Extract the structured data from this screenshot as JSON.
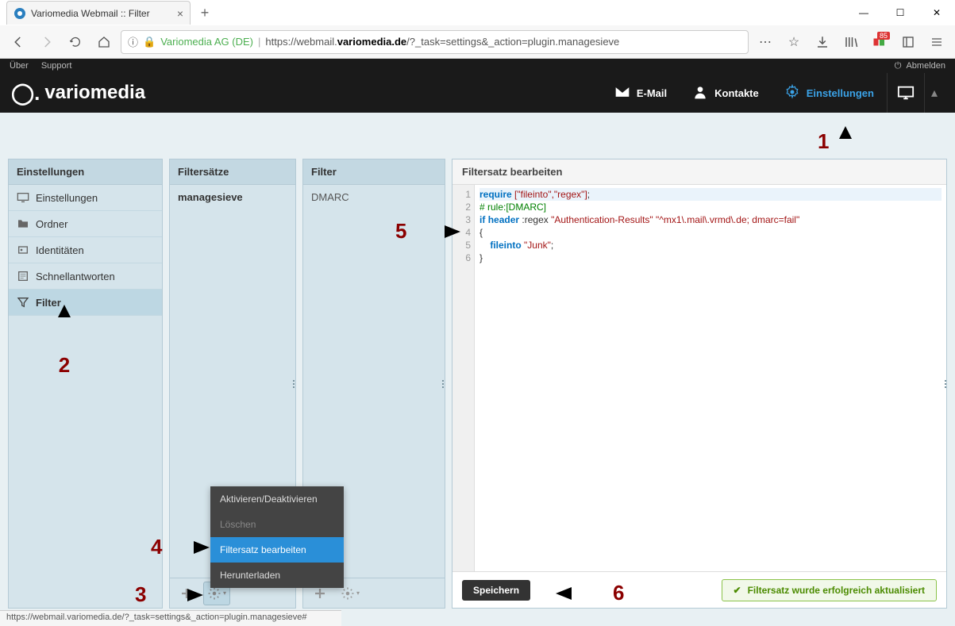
{
  "browser": {
    "tab_title": "Variomedia Webmail :: Filter",
    "site_name": "Variomedia AG (DE)",
    "url_host": "variomedia.de",
    "url_prefix": "https://webmail.",
    "url_path": "/?_task=settings&_action=plugin.managesieve",
    "badge_count": "85"
  },
  "meta": {
    "uber": "Über",
    "support": "Support",
    "logout": "Abmelden"
  },
  "logo_text": "variomedia",
  "header_nav": {
    "email": "E-Mail",
    "contacts": "Kontakte",
    "settings": "Einstellungen"
  },
  "panels": {
    "settings_title": "Einstellungen",
    "settings_items": [
      {
        "label": "Einstellungen",
        "icon": "monitor"
      },
      {
        "label": "Ordner",
        "icon": "folder"
      },
      {
        "label": "Identitäten",
        "icon": "person"
      },
      {
        "label": "Schnellantworten",
        "icon": "note"
      },
      {
        "label": "Filter",
        "icon": "filter",
        "active": true
      }
    ],
    "sets_title": "Filtersätze",
    "sets_items": [
      "managesieve"
    ],
    "filter_title": "Filter",
    "filter_items": [
      "DMARC"
    ]
  },
  "editor": {
    "title": "Filtersatz bearbeiten",
    "lines": [
      "1",
      "2",
      "3",
      "4",
      "5",
      "6"
    ],
    "code": {
      "l1_a": "require",
      "l1_b": "[\"fileinto\",\"regex\"]",
      "l1_c": ";",
      "l2": "# rule:[DMARC]",
      "l3_a": "if",
      "l3_b": "header",
      "l3_c": ":regex",
      "l3_d": "\"Authentication-Results\"",
      "l3_e": "\"^mx1\\.mail\\.vrmd\\.de; dmarc=fail\"",
      "l4": "{",
      "l5_a": "fileinto",
      "l5_b": "\"Junk\"",
      "l5_c": ";",
      "l6": "}"
    },
    "save": "Speichern",
    "success": "Filtersatz wurde erfolgreich aktualisiert"
  },
  "ctx": {
    "toggle": "Aktivieren/Deaktivieren",
    "delete": "Löschen",
    "edit": "Filtersatz bearbeiten",
    "download": "Herunterladen"
  },
  "status_url": "https://webmail.variomedia.de/?_task=settings&_action=plugin.managesieve#",
  "annotations": {
    "n1": "1",
    "n2": "2",
    "n3": "3",
    "n4": "4",
    "n5": "5",
    "n6": "6"
  }
}
